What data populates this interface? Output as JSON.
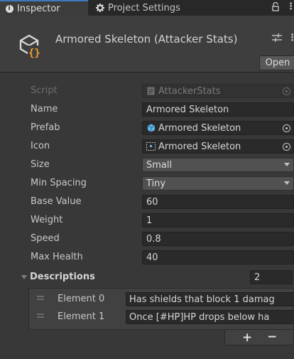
{
  "tabs": [
    {
      "label": "Inspector",
      "icon": "info-icon",
      "active": true
    },
    {
      "label": "Project Settings",
      "icon": "gear-icon",
      "active": false
    }
  ],
  "header": {
    "title": "Armored Skeleton (Attacker Stats)",
    "open_label": "Open"
  },
  "fields": [
    {
      "label": "Script",
      "value": "AttackerStats",
      "kind": "object",
      "icon": "script-icon",
      "disabled": true
    },
    {
      "label": "Name",
      "value": "Armored Skeleton",
      "kind": "text"
    },
    {
      "label": "Prefab",
      "value": "Armored Skeleton",
      "kind": "object",
      "icon": "prefab-cube-icon"
    },
    {
      "label": "Icon",
      "value": "Armored Skeleton",
      "kind": "object",
      "icon": "sprite-icon"
    },
    {
      "label": "Size",
      "value": "Small",
      "kind": "dropdown"
    },
    {
      "label": "Min Spacing",
      "value": "Tiny",
      "kind": "dropdown"
    },
    {
      "label": "Base Value",
      "value": "60",
      "kind": "text"
    },
    {
      "label": "Weight",
      "value": "1",
      "kind": "text"
    },
    {
      "label": "Speed",
      "value": "0.8",
      "kind": "text"
    },
    {
      "label": "Max Health",
      "value": "40",
      "kind": "text"
    }
  ],
  "descriptions": {
    "label": "Descriptions",
    "count": "2",
    "items": [
      {
        "label": "Element 0",
        "value": "Has shields that block 1 damag"
      },
      {
        "label": "Element 1",
        "value": "Once [#HP]HP drops below ha"
      }
    ],
    "add_label": "+",
    "remove_label": "−"
  },
  "colors": {
    "accent": "#3a79bb",
    "prefab_blue": "#5fb5e6",
    "script_orange": "#f0a030",
    "background": "#383838"
  }
}
